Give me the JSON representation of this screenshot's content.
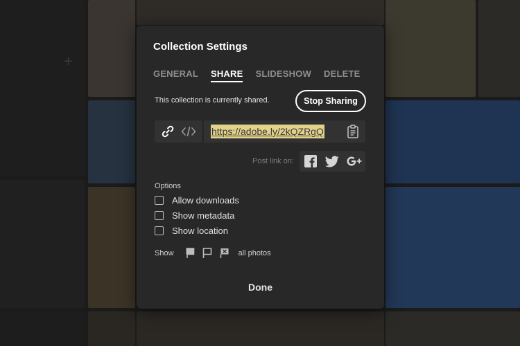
{
  "dialog": {
    "title": "Collection Settings",
    "tabs": [
      {
        "label": "GENERAL",
        "active": false
      },
      {
        "label": "SHARE",
        "active": true
      },
      {
        "label": "SLIDESHOW",
        "active": false
      },
      {
        "label": "DELETE",
        "active": false
      }
    ],
    "share_status": "This collection is currently shared.",
    "stop_sharing_label": "Stop Sharing",
    "share_url": "https://adobe.ly/2kQZRgQ",
    "post_link_label": "Post link on:",
    "options_label": "Options",
    "options": [
      {
        "label": "Allow downloads",
        "checked": false
      },
      {
        "label": "Show metadata",
        "checked": false
      },
      {
        "label": "Show location",
        "checked": false
      }
    ],
    "show_label": "Show",
    "show_filter_value": "all photos",
    "done_label": "Done"
  },
  "icons": {
    "link": "link-icon",
    "embed": "embed-code-icon",
    "clipboard": "clipboard-icon",
    "facebook": "facebook-icon",
    "twitter": "twitter-icon",
    "google_plus": "google-plus-icon",
    "flag_picked": "flag-picked-icon",
    "flag_unflagged": "flag-unflagged-icon",
    "flag_rejected": "flag-rejected-icon"
  },
  "colors": {
    "dialog_bg": "#282828",
    "url_highlight": "#e3d38a",
    "text_primary": "#ffffff",
    "text_muted": "#8e8e8e"
  }
}
